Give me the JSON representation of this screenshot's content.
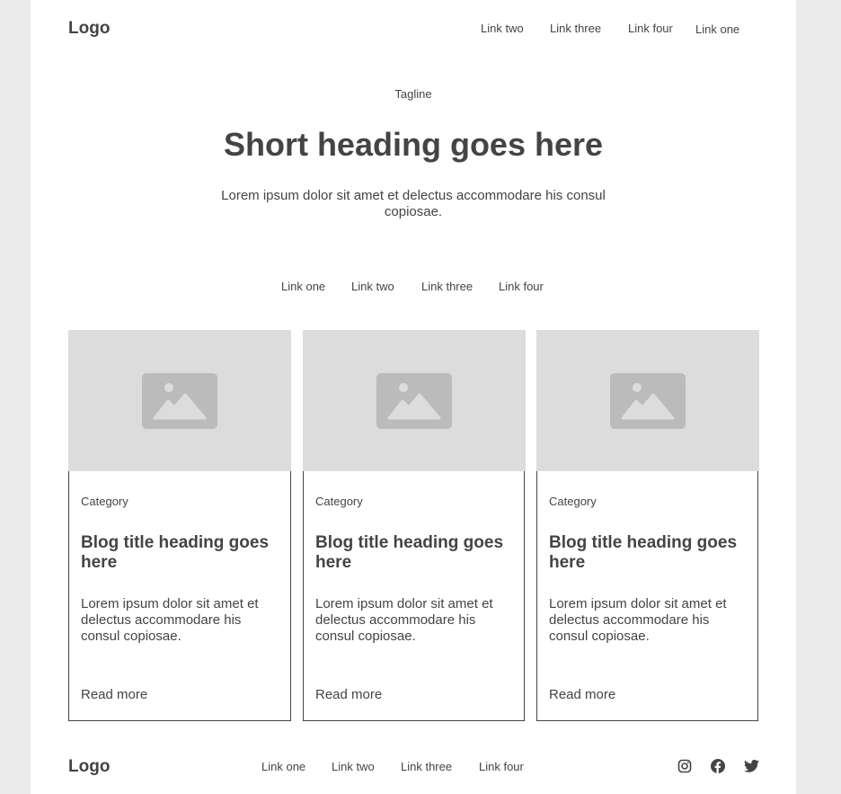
{
  "header": {
    "logo": "Logo",
    "links": [
      "Link two",
      "Link three",
      "Link four",
      "Link one"
    ]
  },
  "hero": {
    "tagline": "Tagline",
    "heading": "Short heading goes here",
    "text": "Lorem ipsum dolor sit amet et delectus accommodare his consul copiosae."
  },
  "filters": [
    "Link one",
    "Link two",
    "Link three",
    "Link four"
  ],
  "cards": [
    {
      "category": "Category",
      "title": "Blog title heading goes here",
      "text": "Lorem ipsum dolor sit amet et delectus accommodare his consul copiosae.",
      "link": "Read more"
    },
    {
      "category": "Category",
      "title": "Blog title heading goes here",
      "text": "Lorem ipsum dolor sit amet et delectus accommodare his consul copiosae.",
      "link": "Read more"
    },
    {
      "category": "Category",
      "title": "Blog title heading goes here",
      "text": "Lorem ipsum dolor sit amet et delectus accommodare his consul copiosae.",
      "link": "Read more"
    }
  ],
  "footer": {
    "logo": "Logo",
    "links": [
      "Link one",
      "Link two",
      "Link three",
      "Link four"
    ],
    "social": [
      "instagram-icon",
      "facebook-icon",
      "twitter-icon"
    ]
  }
}
